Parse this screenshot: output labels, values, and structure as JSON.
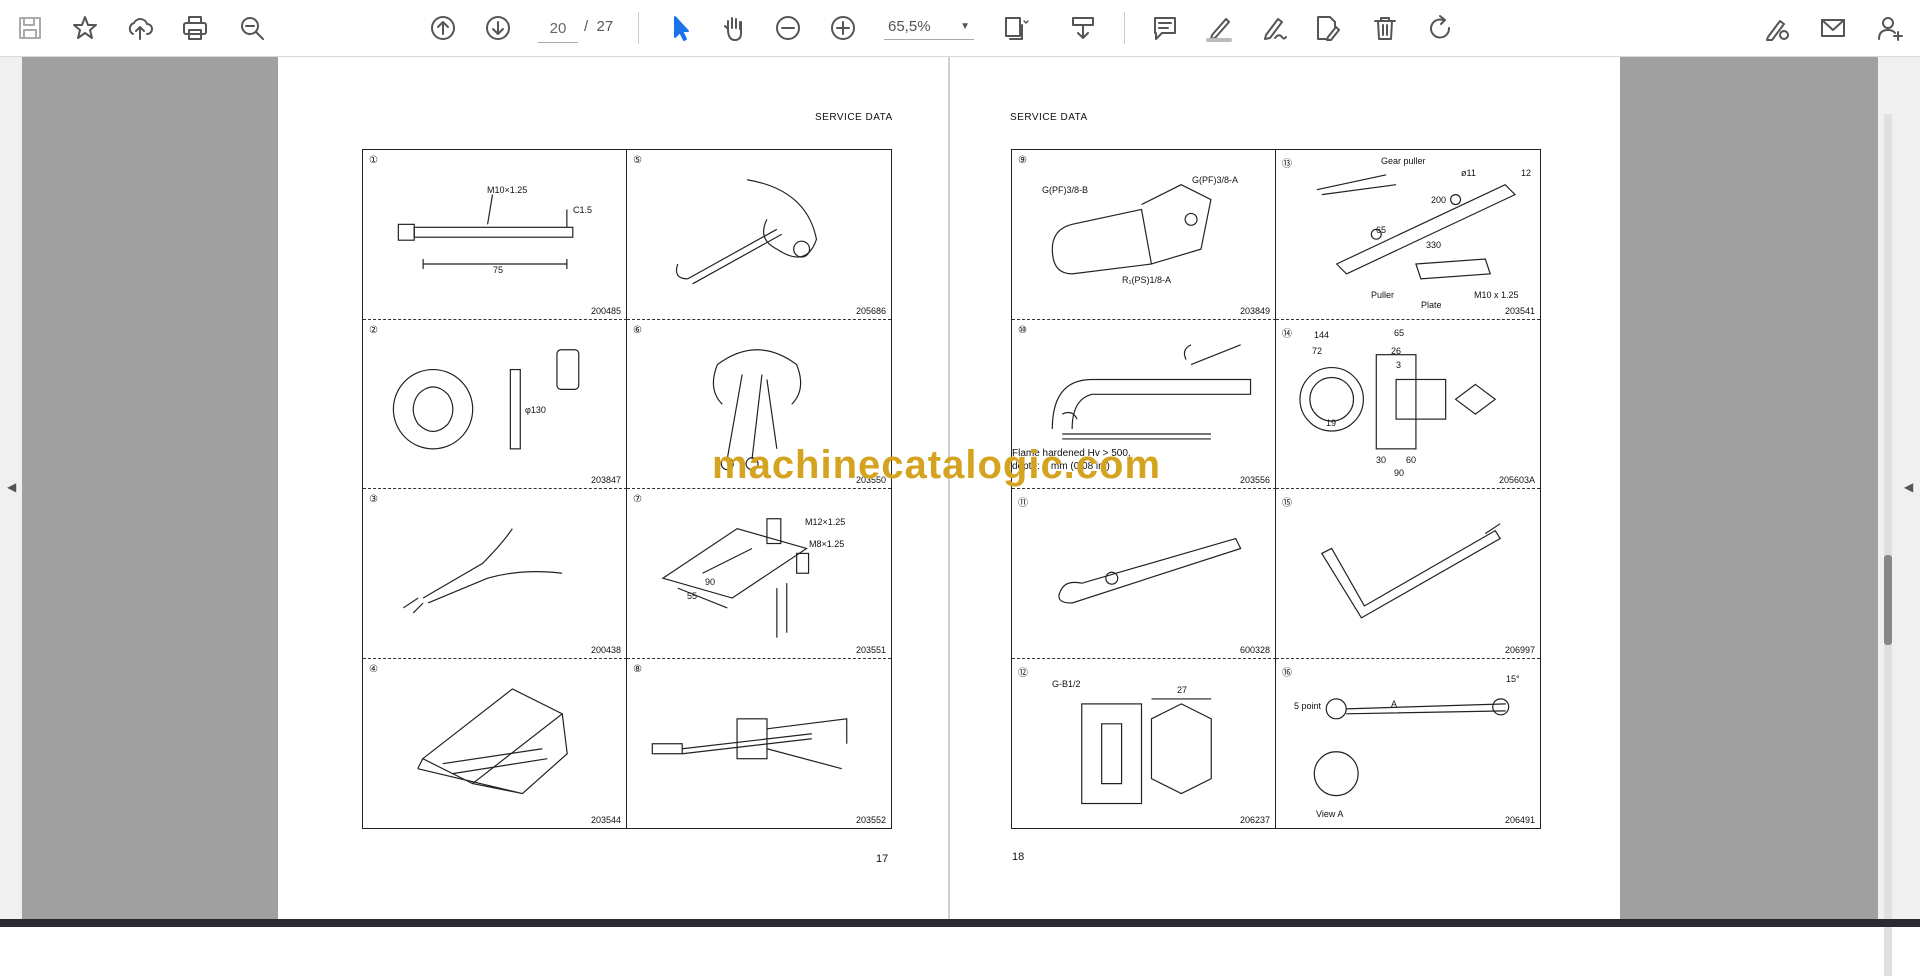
{
  "toolbar": {
    "icons": [
      "save-icon",
      "star-icon",
      "upload-cloud-icon",
      "print-icon",
      "zoom-out-search-icon",
      "page-up-icon",
      "page-down-icon",
      "select-cursor-icon",
      "hand-icon",
      "minus-circle-icon",
      "plus-circle-icon",
      "dropdown-icon",
      "fit-page-icon",
      "download-tray-icon",
      "comment-icon",
      "highlight-pen-icon",
      "sign-pen-icon",
      "stamp-edit-icon",
      "trash-icon",
      "rotate-icon",
      "share-link-icon",
      "mail-icon",
      "add-user-icon"
    ],
    "page_current": "20",
    "page_sep": "/",
    "page_total": "27",
    "zoom": "65,5%"
  },
  "left_page": {
    "header": "SERVICE DATA",
    "page_number": "17",
    "cells": [
      {
        "num": "①",
        "code": "200485",
        "labels": [
          "M10×1.25",
          "C1.5",
          "75"
        ]
      },
      {
        "num": "⑤",
        "code": "205686",
        "labels": []
      },
      {
        "num": "②",
        "code": "203847",
        "labels": [
          "φ130"
        ]
      },
      {
        "num": "⑥",
        "code": "203550",
        "labels": []
      },
      {
        "num": "③",
        "code": "200438",
        "labels": []
      },
      {
        "num": "⑦",
        "code": "203551",
        "labels": [
          "M12×1.25",
          "M8×1.25",
          "90",
          "55"
        ]
      },
      {
        "num": "④",
        "code": "203544",
        "labels": []
      },
      {
        "num": "⑧",
        "code": "203552",
        "labels": []
      }
    ]
  },
  "right_page": {
    "header": "SERVICE DATA",
    "page_number": "18",
    "cells": [
      {
        "num": "⑨",
        "code": "203849",
        "labels": [
          "G(PF)3/8-B",
          "G(PF)3/8-A",
          "R₁(PS)1/8-A"
        ]
      },
      {
        "num": "⑬",
        "code": "203541",
        "labels": [
          "Gear puller",
          "ø11",
          "12",
          "200",
          "65",
          "330",
          "Puller",
          "Plate",
          "M10 x 1.25"
        ]
      },
      {
        "num": "⑩",
        "code": "203556",
        "labels": [
          "Flame hardened Hv > 500,",
          "depth: 2 mm (0.08 in.)"
        ]
      },
      {
        "num": "⑭",
        "code": "205603A",
        "labels": [
          "144",
          "65",
          "72",
          "26",
          "3",
          "19",
          "30",
          "60",
          "90"
        ]
      },
      {
        "num": "⑪",
        "code": "600328",
        "labels": []
      },
      {
        "num": "⑮",
        "code": "206997",
        "labels": []
      },
      {
        "num": "⑫",
        "code": "206237",
        "labels": [
          "G-B1/2",
          "27"
        ]
      },
      {
        "num": "⑯",
        "code": "206491",
        "labels": [
          "5 point",
          "A",
          "15°",
          "View A"
        ]
      }
    ]
  },
  "watermark": "machinecatalogic.com",
  "side_arrows": {
    "left": "◀",
    "right": "◀"
  }
}
